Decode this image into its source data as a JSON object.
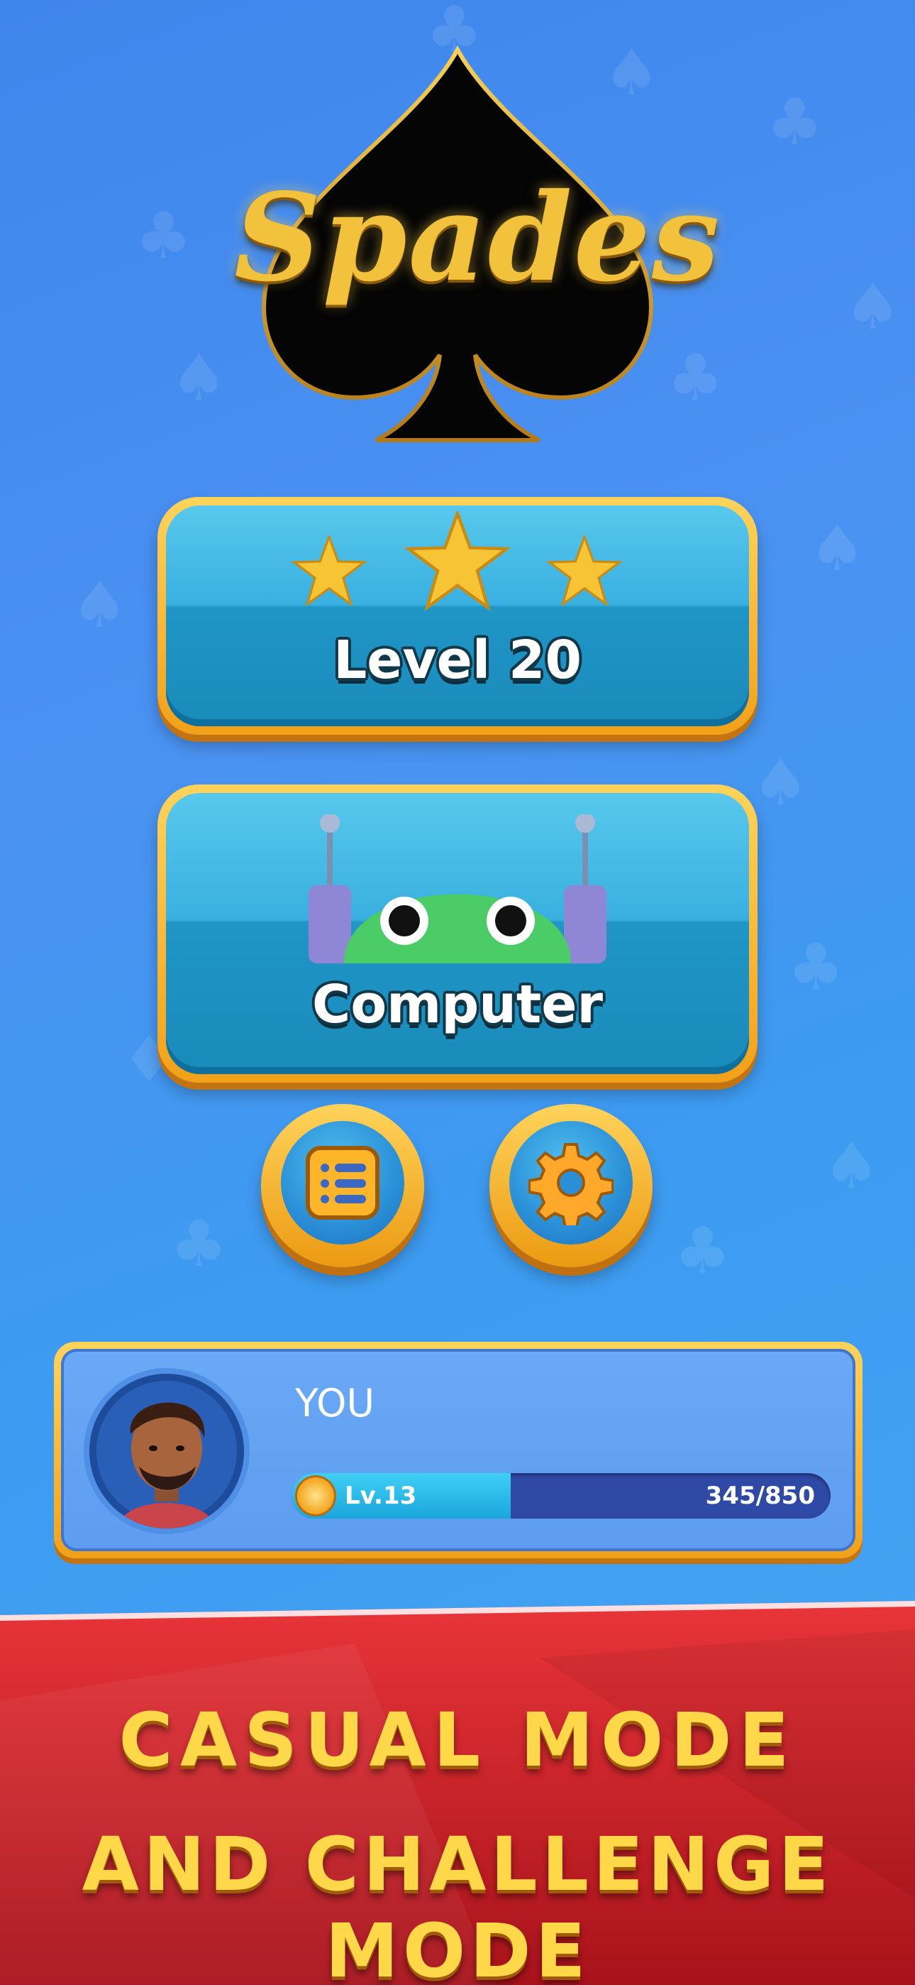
{
  "logo": {
    "title": "Spades",
    "icon": "spade-icon"
  },
  "level_button": {
    "label": "Level 20",
    "stars": 3,
    "icon": "star-icon"
  },
  "computer_button": {
    "label": "Computer",
    "icon": "robot-icon"
  },
  "menu_button": {
    "icon": "list-icon"
  },
  "settings_button": {
    "icon": "gear-icon"
  },
  "profile": {
    "name": "YOU",
    "level_label": "Lv.13",
    "xp_text": "345/850",
    "xp_progress": 0.406
  },
  "banner": {
    "line1": "CASUAL MODE",
    "line2": "AND CHALLENGE MODE"
  },
  "colors": {
    "background": "#4a92f2",
    "gold": "#f3c23c",
    "button_teal": "#39b0e0",
    "banner_red": "#d8232a",
    "banner_text": "#ffd84a"
  }
}
